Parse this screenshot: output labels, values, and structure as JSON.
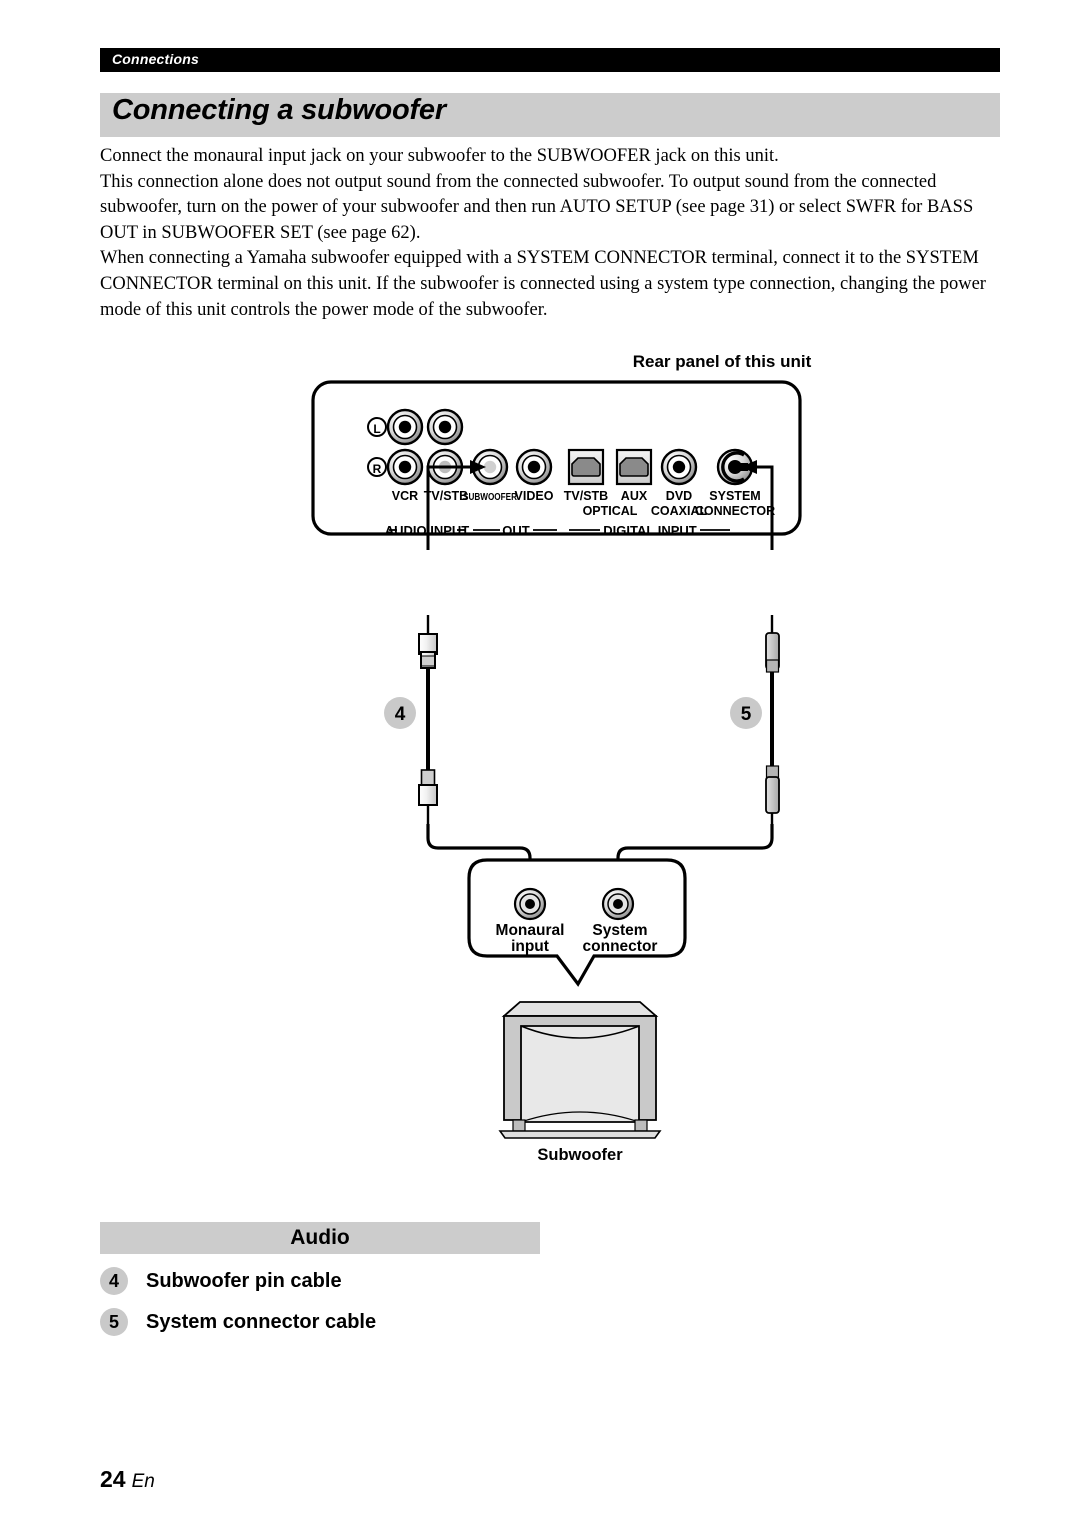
{
  "header": {
    "section": "Connections",
    "title": "Connecting a subwoofer"
  },
  "intro": {
    "paragraphs": [
      "Connect the monaural input jack on your subwoofer to the SUBWOOFER jack on this unit.",
      "This connection alone does not output sound from the connected subwoofer. To output sound from the connected subwoofer, turn on the power of your subwoofer and then run AUTO SETUP (see page 31) or select SWFR for BASS OUT in SUBWOOFER SET (see page 62).",
      "When connecting a Yamaha subwoofer equipped with a SYSTEM CONNECTOR terminal, connect it to the SYSTEM CONNECTOR terminal on this unit. If the subwoofer is connected using a system type connection, changing the power mode of this unit controls the power mode of the subwoofer."
    ]
  },
  "diagram": {
    "rear_panel_caption": "Rear panel of this unit",
    "channel_labels": {
      "left": "L",
      "right": "R"
    },
    "jack_labels": [
      "VCR",
      "TV/STB",
      "SUBWOOFER",
      "VIDEO",
      "TV/STB",
      "AUX",
      "DVD",
      "SYSTEM"
    ],
    "jack_sublabels": {
      "optical": "OPTICAL",
      "coaxial": "COAXIAL",
      "connector": "CONNECTOR"
    },
    "group_labels": {
      "audio_input": "AUDIO INPUT",
      "out": "OUT",
      "digital_input": "DIGITAL INPUT"
    },
    "callouts": {
      "cable_4": "4",
      "cable_5": "5"
    },
    "subwoofer_bubble": {
      "monaural_input_line1": "Monaural",
      "monaural_input_line2": "input",
      "system_connector_line1": "System",
      "system_connector_line2": "connector"
    },
    "subwoofer_caption": "Subwoofer"
  },
  "legend": {
    "heading": "Audio",
    "items": [
      {
        "num": "4",
        "label": "Subwoofer pin cable"
      },
      {
        "num": "5",
        "label": "System connector cable"
      }
    ]
  },
  "footer": {
    "page_number": "24",
    "language": "En"
  },
  "colors": {
    "bar_black": "#000000",
    "bar_gray": "#cccccc",
    "callout_gray": "#c9c9c9",
    "panel_face": "#ffffff"
  }
}
